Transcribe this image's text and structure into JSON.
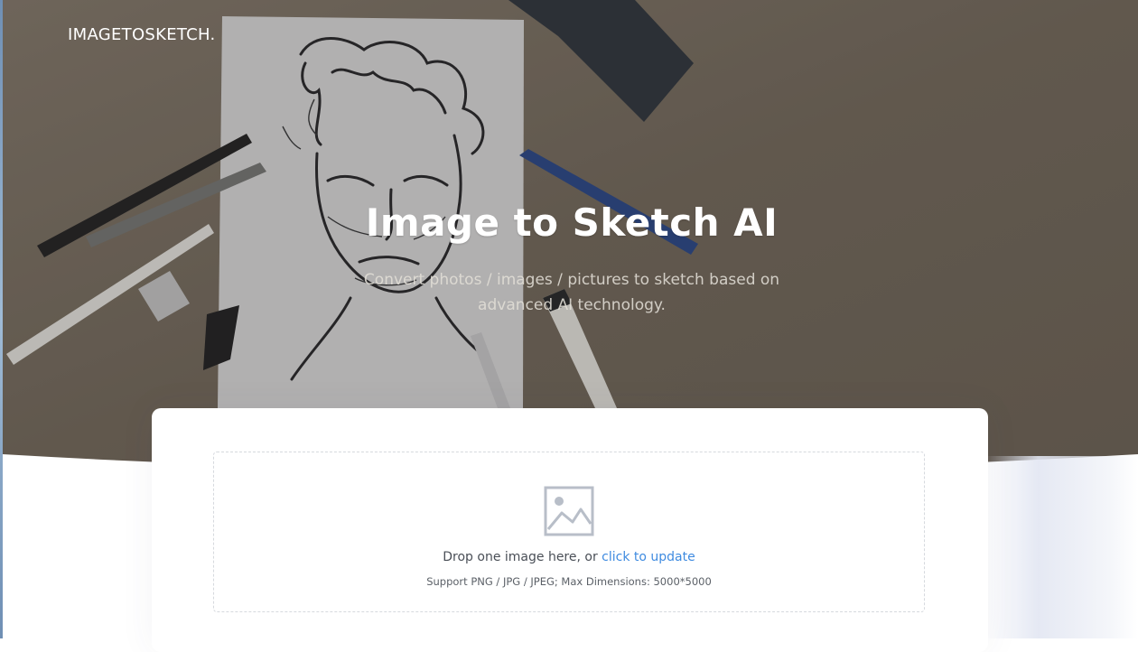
{
  "header": {
    "brand": "IMAGETOSKETCH."
  },
  "hero": {
    "title": "Image to Sketch AI",
    "subtitle": "Convert photos / images / pictures to sketch based on advanced AI technology."
  },
  "upload": {
    "icon": "image-placeholder-icon",
    "drop_prefix": "Drop one image here, or ",
    "drop_link": "click to update",
    "support": "Support PNG / JPG / JPEG; Max Dimensions: 5000*5000"
  },
  "colors": {
    "hero_overlay": "#6b6155",
    "link": "#3f8be0",
    "text": "#4a4f57"
  }
}
